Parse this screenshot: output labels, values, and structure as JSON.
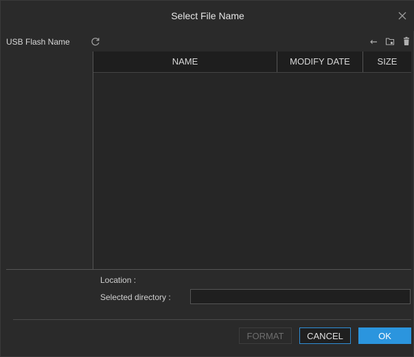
{
  "dialog": {
    "title": "Select File Name"
  },
  "toolbar": {
    "device_label": "USB Flash Name"
  },
  "table": {
    "columns": [
      "NAME",
      "MODIFY DATE",
      "SIZE"
    ]
  },
  "form": {
    "location_label": "Location :",
    "directory_label": "Selected directory :",
    "directory_value": ""
  },
  "buttons": {
    "format": "FORMAT",
    "cancel": "CANCEL",
    "ok": "OK"
  },
  "colors": {
    "accent": "#2b95de",
    "background": "#2a2a2a"
  },
  "icons": [
    "close-icon",
    "refresh-icon",
    "back-arrow-icon",
    "new-folder-icon",
    "delete-icon"
  ]
}
